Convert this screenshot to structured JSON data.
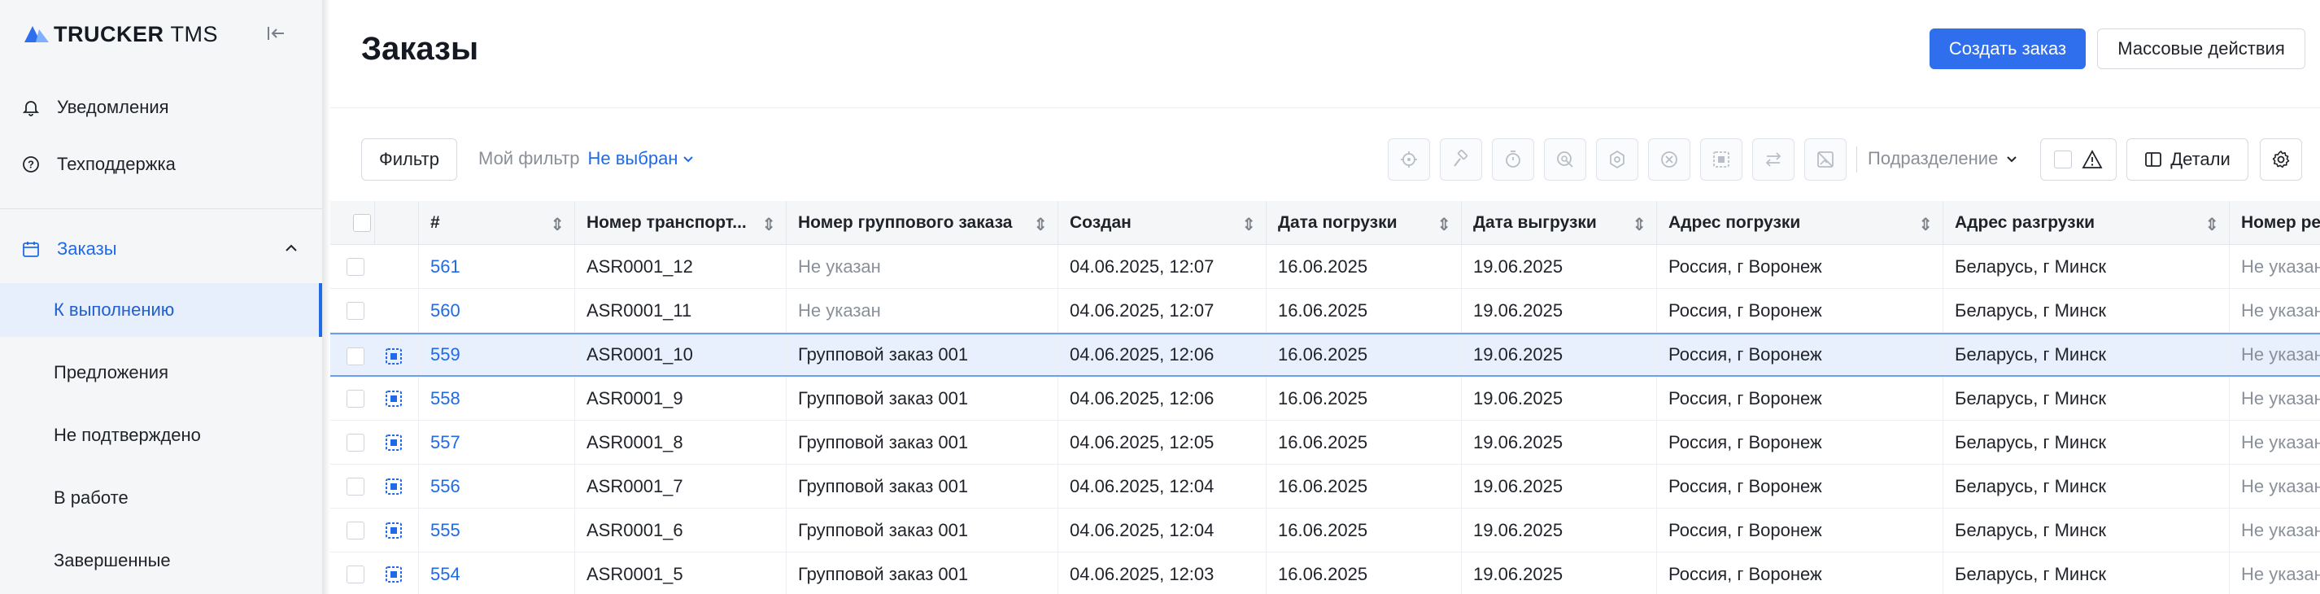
{
  "app": {
    "logo_brand": "TRUCKER",
    "logo_suffix": "TMS"
  },
  "sidebar": {
    "items": [
      {
        "label": "Уведомления",
        "icon": "bell-icon"
      },
      {
        "label": "Техподдержка",
        "icon": "help-circle-icon"
      }
    ],
    "orders_label": "Заказы",
    "orders_icon": "calendar-icon",
    "sub_items": [
      {
        "label": "К выполнению",
        "active": true
      },
      {
        "label": "Предложения",
        "active": false
      },
      {
        "label": "Не подтверждено",
        "active": false
      },
      {
        "label": "В работе",
        "active": false
      },
      {
        "label": "Завершенные",
        "active": false
      }
    ]
  },
  "header": {
    "title": "Заказы",
    "create_label": "Создать заказ",
    "bulk_label": "Массовые действия"
  },
  "toolbar": {
    "filter_label": "Фильтр",
    "my_filter_label": "Мой фильтр",
    "my_filter_value": "Не выбран",
    "subdivision_label": "Подразделение",
    "details_label": "Детали",
    "icons": [
      "target-icon",
      "hammer-icon",
      "timer-icon",
      "search-doc-icon",
      "settings-gear-icon",
      "cancel-circle-icon",
      "group-select-icon",
      "swap-icon",
      "no-image-icon"
    ]
  },
  "table": {
    "headers": [
      "#",
      "Номер транспорт...",
      "Номер группового заказа",
      "Создан",
      "Дата погрузки",
      "Дата выгрузки",
      "Адрес погрузки",
      "Адрес разгрузки",
      "Номер ре"
    ],
    "rows": [
      {
        "num": "561",
        "transport": "ASR0001_12",
        "group": "Не указан",
        "created": "04.06.2025, 12:07",
        "load": "16.06.2025",
        "unload": "19.06.2025",
        "from": "Россия, г Воронеж",
        "to": "Беларусь, г Минск",
        "extra": "Не указан",
        "has_group": false,
        "selected": false
      },
      {
        "num": "560",
        "transport": "ASR0001_11",
        "group": "Не указан",
        "created": "04.06.2025, 12:07",
        "load": "16.06.2025",
        "unload": "19.06.2025",
        "from": "Россия, г Воронеж",
        "to": "Беларусь, г Минск",
        "extra": "Не указан",
        "has_group": false,
        "selected": false
      },
      {
        "num": "559",
        "transport": "ASR0001_10",
        "group": "Групповой заказ 001",
        "created": "04.06.2025, 12:06",
        "load": "16.06.2025",
        "unload": "19.06.2025",
        "from": "Россия, г Воронеж",
        "to": "Беларусь, г Минск",
        "extra": "Не указан",
        "has_group": true,
        "selected": true
      },
      {
        "num": "558",
        "transport": "ASR0001_9",
        "group": "Групповой заказ 001",
        "created": "04.06.2025, 12:06",
        "load": "16.06.2025",
        "unload": "19.06.2025",
        "from": "Россия, г Воронеж",
        "to": "Беларусь, г Минск",
        "extra": "Не указан",
        "has_group": true,
        "selected": false
      },
      {
        "num": "557",
        "transport": "ASR0001_8",
        "group": "Групповой заказ 001",
        "created": "04.06.2025, 12:05",
        "load": "16.06.2025",
        "unload": "19.06.2025",
        "from": "Россия, г Воронеж",
        "to": "Беларусь, г Минск",
        "extra": "Не указан",
        "has_group": true,
        "selected": false
      },
      {
        "num": "556",
        "transport": "ASR0001_7",
        "group": "Групповой заказ 001",
        "created": "04.06.2025, 12:04",
        "load": "16.06.2025",
        "unload": "19.06.2025",
        "from": "Россия, г Воронеж",
        "to": "Беларусь, г Минск",
        "extra": "Не указан",
        "has_group": true,
        "selected": false
      },
      {
        "num": "555",
        "transport": "ASR0001_6",
        "group": "Групповой заказ 001",
        "created": "04.06.2025, 12:04",
        "load": "16.06.2025",
        "unload": "19.06.2025",
        "from": "Россия, г Воронеж",
        "to": "Беларусь, г Минск",
        "extra": "Не указан",
        "has_group": true,
        "selected": false
      },
      {
        "num": "554",
        "transport": "ASR0001_5",
        "group": "Групповой заказ 001",
        "created": "04.06.2025, 12:03",
        "load": "16.06.2025",
        "unload": "19.06.2025",
        "from": "Россия, г Воронеж",
        "to": "Беларусь, г Минск",
        "extra": "Не указан",
        "has_group": true,
        "selected": false
      }
    ]
  },
  "colors": {
    "accent": "#2f6fed",
    "link": "#1f6ae8",
    "muted": "#8a9099",
    "sidebar_bg": "#f5f6f8",
    "active_bg": "#e7eefc"
  }
}
